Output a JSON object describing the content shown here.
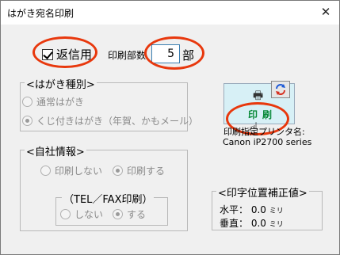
{
  "window": {
    "title": "はがき宛名印刷",
    "close_glyph": "✕"
  },
  "return_mail": {
    "label": "返信用",
    "checked": true
  },
  "copies": {
    "label": "印刷部数",
    "value": "5",
    "unit": "部"
  },
  "card_type": {
    "title": "<はがき種別>",
    "options": [
      {
        "label": "通常はがき",
        "selected": false
      },
      {
        "label": "くじ付きはがき（年賀、かもメール）",
        "selected": true
      }
    ]
  },
  "company_info": {
    "title": "<自社情報>",
    "options": [
      {
        "label": "印刷しない",
        "selected": false
      },
      {
        "label": "印刷する",
        "selected": true
      }
    ],
    "tel_fax": {
      "title": "（TEL／FAX印刷）",
      "options": [
        {
          "label": "しない",
          "selected": false
        },
        {
          "label": "する",
          "selected": true
        }
      ]
    }
  },
  "print": {
    "button_label": "印刷",
    "printer_label": "印刷指定プリンタ名:",
    "printer_name": "Canon iP2700 series",
    "icons": [
      "printer-icon",
      "refresh-icon",
      "hand-cursor-icon"
    ]
  },
  "offset": {
    "title": "<印字位置補正値>",
    "horizontal_label": "水平：",
    "horizontal_value": "0.0",
    "vertical_label": "垂直：",
    "vertical_value": "0.0",
    "unit": "ミリ"
  },
  "colors": {
    "highlight_ellipse": "#e8380d",
    "print_button_bg": "#d7f0f6",
    "print_button_text": "#0a8a3a"
  }
}
